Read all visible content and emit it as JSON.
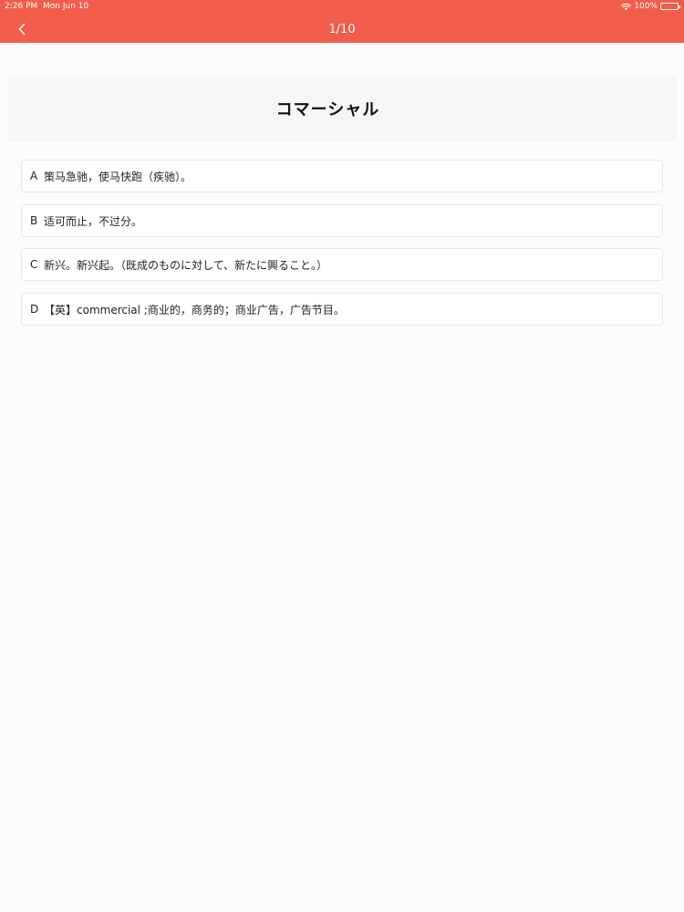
{
  "status_bar": {
    "time": "2:26 PM",
    "date": "Mon Jun 10",
    "battery": "100%"
  },
  "nav": {
    "title": "1/10",
    "back_icon": "chevron-left-icon"
  },
  "question": {
    "word": "コマーシャル"
  },
  "options": [
    {
      "letter": "A",
      "text": "策马急驰，使马快跑（疾驰）。"
    },
    {
      "letter": "B",
      "text": "适可而止，不过分。"
    },
    {
      "letter": "C",
      "text": "新兴。新兴起。（既成のものに対して、新たに興ること。）"
    },
    {
      "letter": "D",
      "text": "【英】commercial ;商业的，商务的；商业广告，广告节目。"
    }
  ],
  "colors": {
    "header": "#f25d4b",
    "background": "#fbfcfc",
    "word_panel": "#f4f6f7"
  }
}
